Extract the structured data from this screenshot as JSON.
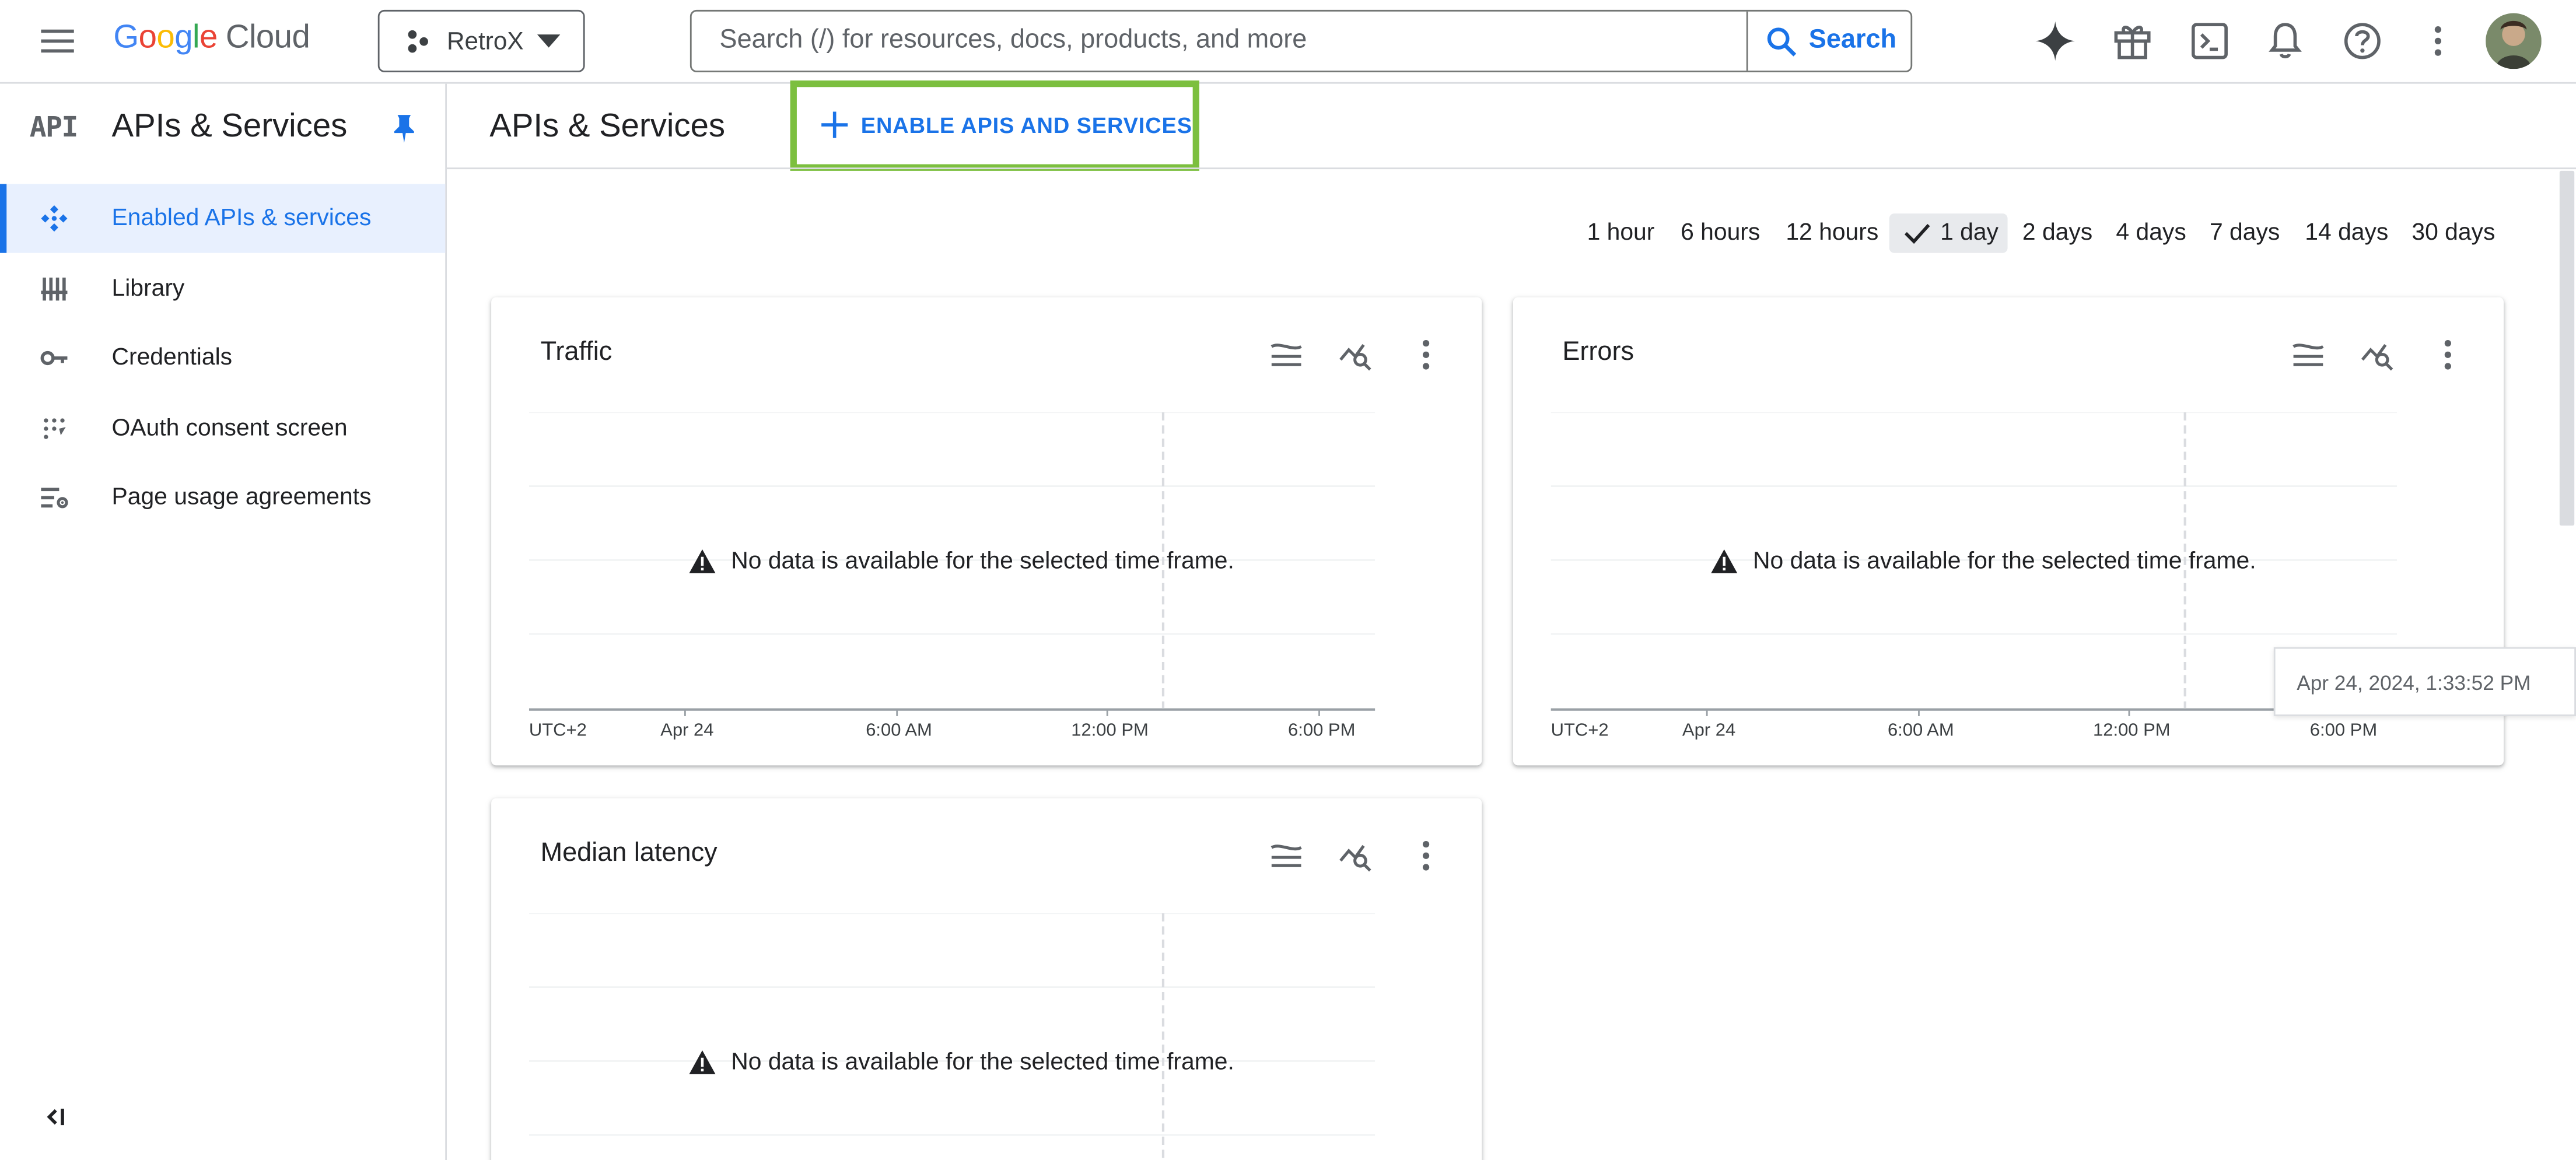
{
  "header": {
    "logo_google": [
      "G",
      "o",
      "o",
      "g",
      "l",
      "e"
    ],
    "logo_cloud": "Cloud",
    "project": "RetroX",
    "search_placeholder": "Search (/) for resources, docs, products, and more",
    "search_button": "Search",
    "icons": [
      "gemini-icon",
      "gift-icon",
      "cloud-shell-icon",
      "notifications-icon",
      "help-icon",
      "more-vert-icon",
      "avatar"
    ]
  },
  "sidebar": {
    "logo_text": "API",
    "title": "APIs & Services",
    "items": [
      {
        "label": "Enabled APIs & services",
        "icon": "enabled-apis-icon",
        "active": true
      },
      {
        "label": "Library",
        "icon": "library-icon",
        "active": false
      },
      {
        "label": "Credentials",
        "icon": "key-icon",
        "active": false
      },
      {
        "label": "OAuth consent screen",
        "icon": "oauth-icon",
        "active": false
      },
      {
        "label": "Page usage agreements",
        "icon": "page-usage-icon",
        "active": false
      }
    ]
  },
  "main": {
    "title": "APIs & Services",
    "enable_button": "ENABLE APIS AND SERVICES",
    "time_ranges": [
      {
        "label": "1 hour",
        "selected": false
      },
      {
        "label": "6 hours",
        "selected": false
      },
      {
        "label": "12 hours",
        "selected": false
      },
      {
        "label": "1 day",
        "selected": true
      },
      {
        "label": "2 days",
        "selected": false
      },
      {
        "label": "4 days",
        "selected": false
      },
      {
        "label": "7 days",
        "selected": false
      },
      {
        "label": "14 days",
        "selected": false
      },
      {
        "label": "30 days",
        "selected": false
      }
    ]
  },
  "cards": [
    {
      "title": "Traffic",
      "no_data": "No data is available for the selected time frame."
    },
    {
      "title": "Errors",
      "no_data": "No data is available for the selected time frame."
    },
    {
      "title": "Median latency",
      "no_data": "No data is available for the selected time frame."
    }
  ],
  "chart_axis": {
    "timezone": "UTC+2",
    "ticks": [
      "Apr 24",
      "6:00 AM",
      "12:00 PM",
      "6:00 PM"
    ]
  },
  "tooltip": "Apr 24, 2024, 1:33:52 PM",
  "colors": {
    "accent": "#1a73e8",
    "highlight_border": "#7cbf3f",
    "active_bg": "#e8f0fe"
  }
}
